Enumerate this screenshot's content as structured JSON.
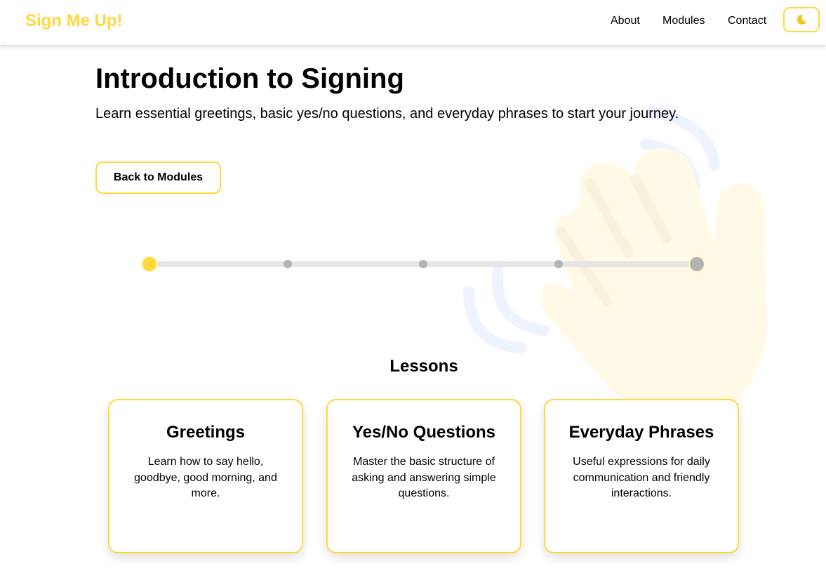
{
  "header": {
    "brand": "Sign Me Up!",
    "nav": [
      "About",
      "Modules",
      "Contact"
    ],
    "theme_toggle_icon": "moon-icon"
  },
  "module": {
    "title": "Introduction to Signing",
    "description": "Learn essential greetings, basic yes/no questions, and everyday phrases to start your journey."
  },
  "back_button": "Back to Modules",
  "progress": {
    "steps": 5,
    "current_step": 1
  },
  "lessons": {
    "heading": "Lessons",
    "items": [
      {
        "title": "Greetings",
        "description": "Learn how to say hello, goodbye, good morning, and more."
      },
      {
        "title": "Yes/No Questions",
        "description": "Master the basic structure of asking and answering simple questions."
      },
      {
        "title": "Everyday Phrases",
        "description": "Useful expressions for daily communication and friendly interactions."
      }
    ]
  },
  "colors": {
    "accent": "#ffd83d",
    "progress_track": "#e6e6e6",
    "progress_dot": "#b3b3b3",
    "hand_decoration": "#fff9e6",
    "wave_decoration": "#eef4ff"
  },
  "decoration_icon": "waving-hand-icon"
}
